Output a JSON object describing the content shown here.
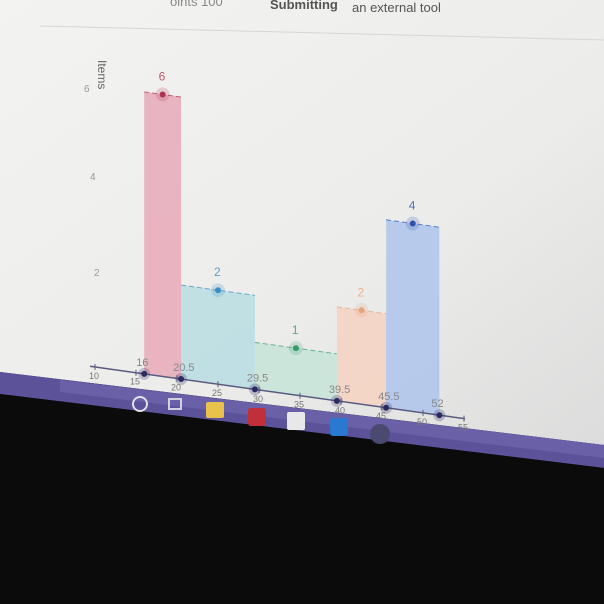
{
  "header": {
    "points_text": "oints 100",
    "submitting_label": "Submitting",
    "tool_text": "an external tool"
  },
  "taskbar": {
    "icons": [
      "search-circle-icon",
      "task-view-icon",
      "file-explorer-icon",
      "mcafee-icon",
      "store-icon",
      "app-icon",
      "chrome-icon"
    ]
  },
  "chart_data": {
    "type": "bar",
    "ylabel": "Items",
    "ytick_labels": [
      "2",
      "4",
      "6"
    ],
    "ylim": [
      0,
      6
    ],
    "xlim": [
      10,
      55
    ],
    "xtick_labels": [
      "10",
      "15",
      "20",
      "25",
      "30",
      "35",
      "40",
      "45",
      "50",
      "55"
    ],
    "bins": [
      {
        "left": 16,
        "right": 20.5,
        "value": 6,
        "color": "#e8a9b8",
        "marker": "#b03050"
      },
      {
        "left": 20.5,
        "right": 29.5,
        "value": 2,
        "color": "#b8dde3",
        "marker": "#3a8fc8"
      },
      {
        "left": 29.5,
        "right": 39.5,
        "value": 1,
        "color": "#c5e4d8",
        "marker": "#3a9a6a"
      },
      {
        "left": 39.5,
        "right": 45.5,
        "value": 2,
        "color": "#f6d2c2",
        "marker": "#e8a27a"
      },
      {
        "left": 45.5,
        "right": 52,
        "value": 4,
        "color": "#aec4ec",
        "marker": "#3050b0"
      }
    ],
    "boundary_labels": [
      "16",
      "20.5",
      "29.5",
      "39.5",
      "45.5",
      "52"
    ]
  }
}
